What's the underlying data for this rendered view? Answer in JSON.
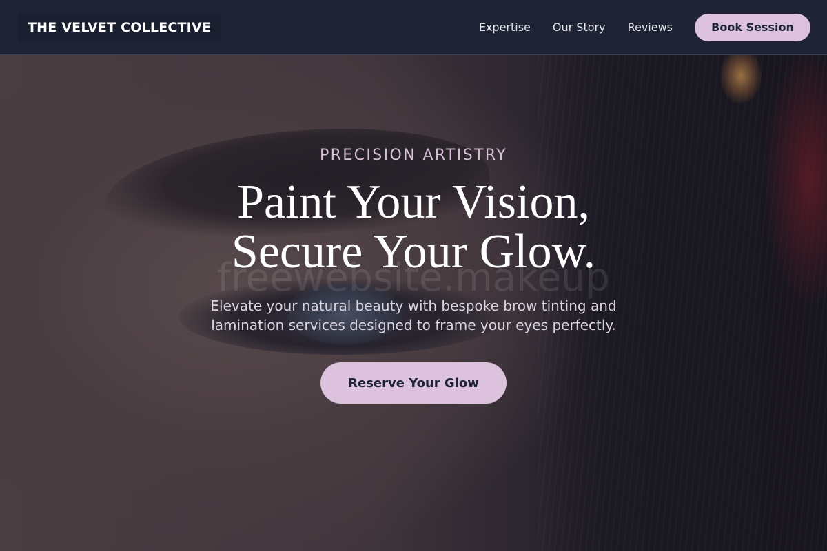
{
  "header": {
    "brand": "THE VELVET COLLECTIVE",
    "nav": [
      {
        "label": "Expertise"
      },
      {
        "label": "Our Story"
      },
      {
        "label": "Reviews"
      }
    ],
    "cta_label": "Book Session"
  },
  "hero": {
    "eyebrow": "PRECISION ARTISTRY",
    "headline_line1": "Paint Your Vision,",
    "headline_line2": "Secure Your Glow.",
    "watermark": "freewebsite.makeup",
    "subtitle": "Elevate your natural beauty with bespoke brow tinting and lamination services designed to frame your eyes perfectly.",
    "cta_label": "Reserve Your Glow"
  },
  "colors": {
    "header_bg": "#1e2436",
    "accent": "#dcc2dc",
    "eyebrow": "#d7bfd8",
    "text_primary": "#ffffff"
  }
}
